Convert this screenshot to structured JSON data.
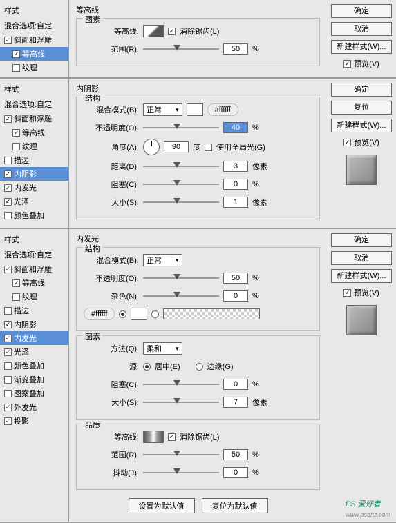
{
  "common": {
    "styleTitle": "样式",
    "blendOptions": "混合选项:自定",
    "ok": "确定",
    "cancel": "取消",
    "reset": "复位",
    "newStyle": "新建样式(W)...",
    "previewLabel": "预览(V)",
    "antiAlias": "消除锯齿(L)",
    "contourLabel": "等高线:",
    "rangeLabel": "范围(R):",
    "blendModeLabel": "混合模式(B):",
    "normal": "正常",
    "opacityLabel": "不透明度(O):",
    "angleLabel": "角度(A):",
    "degree": "度",
    "useGlobal": "使用全局光(G)",
    "distanceLabel": "距离(D):",
    "chokeLabel": "阻塞(C):",
    "sizeLabel": "大小(S):",
    "pixels": "像素",
    "noiseLabel": "杂色(N):",
    "methodLabel": "方法(Q):",
    "soft": "柔和",
    "sourceLabel": "源:",
    "center": "居中(E)",
    "edge": "边缘(G)",
    "jitterLabel": "抖动(J):",
    "percent": "%",
    "setDefault": "设置为默认值",
    "resetDefault": "复位为默认值",
    "hexWhite": "#ffffff",
    "watermark": "PS 爱好者",
    "watermarkUrl": "www.psahz.com"
  },
  "panel1": {
    "title": "等高线",
    "groupElements": "图素",
    "range": "50",
    "styles": [
      {
        "label": "斜面和浮雕",
        "checked": true,
        "sel": false,
        "sub": false
      },
      {
        "label": "等高线",
        "checked": true,
        "sel": true,
        "sub": true
      },
      {
        "label": "纹理",
        "checked": false,
        "sel": false,
        "sub": true
      }
    ]
  },
  "panel2": {
    "title": "内阴影",
    "groupStructure": "结构",
    "opacity": "40",
    "angle": "90",
    "distance": "3",
    "choke": "0",
    "size": "1",
    "styles": [
      {
        "label": "斜面和浮雕",
        "checked": true,
        "sub": false
      },
      {
        "label": "等高线",
        "checked": true,
        "sub": true
      },
      {
        "label": "纹理",
        "checked": false,
        "sub": true
      },
      {
        "label": "描边",
        "checked": false,
        "sub": false
      },
      {
        "label": "内阴影",
        "checked": true,
        "sub": false,
        "sel": true
      },
      {
        "label": "内发光",
        "checked": true,
        "sub": false
      },
      {
        "label": "光泽",
        "checked": true,
        "sub": false
      },
      {
        "label": "颜色叠加",
        "checked": false,
        "sub": false
      }
    ]
  },
  "panel3": {
    "title": "内发光",
    "groupStructure": "结构",
    "groupElements": "图素",
    "groupQuality": "品质",
    "opacity": "50",
    "noise": "0",
    "choke": "0",
    "size": "7",
    "range": "50",
    "jitter": "0",
    "styles": [
      {
        "label": "斜面和浮雕",
        "checked": true,
        "sub": false
      },
      {
        "label": "等高线",
        "checked": true,
        "sub": true
      },
      {
        "label": "纹理",
        "checked": false,
        "sub": true
      },
      {
        "label": "描边",
        "checked": false,
        "sub": false
      },
      {
        "label": "内阴影",
        "checked": true,
        "sub": false
      },
      {
        "label": "内发光",
        "checked": true,
        "sub": false,
        "sel": true
      },
      {
        "label": "光泽",
        "checked": true,
        "sub": false
      },
      {
        "label": "颜色叠加",
        "checked": false,
        "sub": false
      },
      {
        "label": "渐变叠加",
        "checked": false,
        "sub": false
      },
      {
        "label": "图案叠加",
        "checked": false,
        "sub": false
      },
      {
        "label": "外发光",
        "checked": true,
        "sub": false
      },
      {
        "label": "投影",
        "checked": true,
        "sub": false
      }
    ]
  }
}
